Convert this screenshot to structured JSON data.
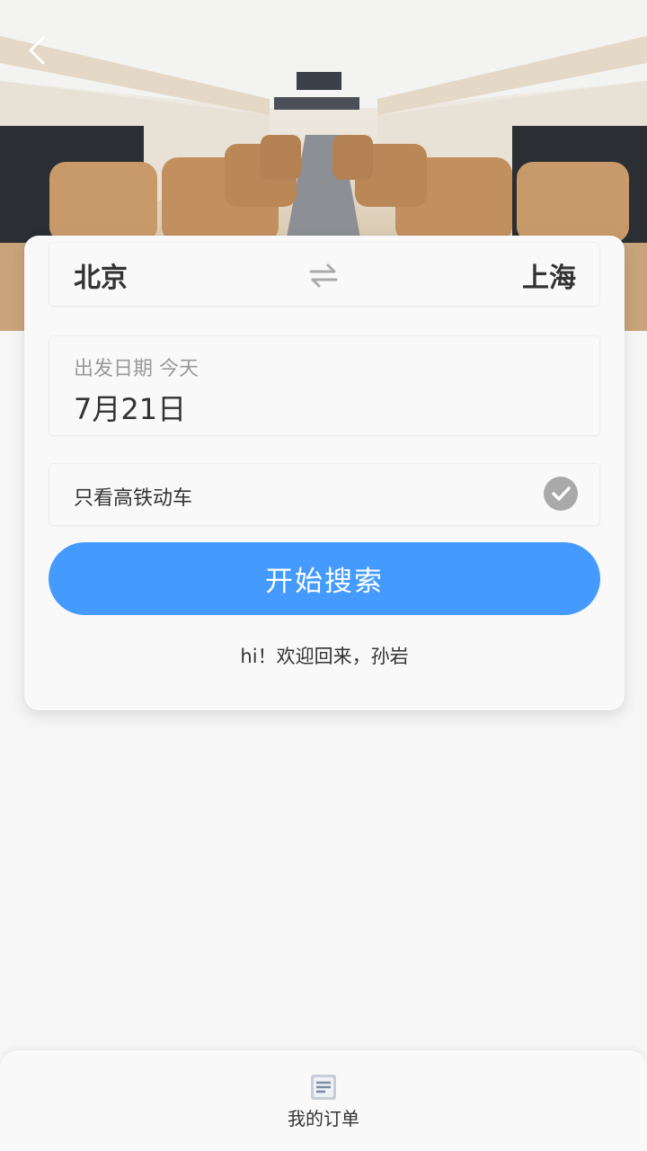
{
  "route": {
    "from_city": "北京",
    "to_city": "上海"
  },
  "date": {
    "label": "出发日期 今天",
    "value": "7月21日"
  },
  "filter": {
    "label": "只看高铁动车",
    "checked": true
  },
  "search": {
    "button_label": "开始搜索"
  },
  "welcome": {
    "text": "hi！欢迎回来，孙岩"
  },
  "tabbar": {
    "orders_label": "我的订单"
  },
  "colors": {
    "accent": "#449bfd",
    "background": "#f6f6f6",
    "check_inactive": "#a9a9a9"
  },
  "icons": {
    "back": "chevron-left-icon",
    "swap": "swap-arrows-icon",
    "check": "check-circle-icon",
    "orders": "orders-list-icon"
  }
}
